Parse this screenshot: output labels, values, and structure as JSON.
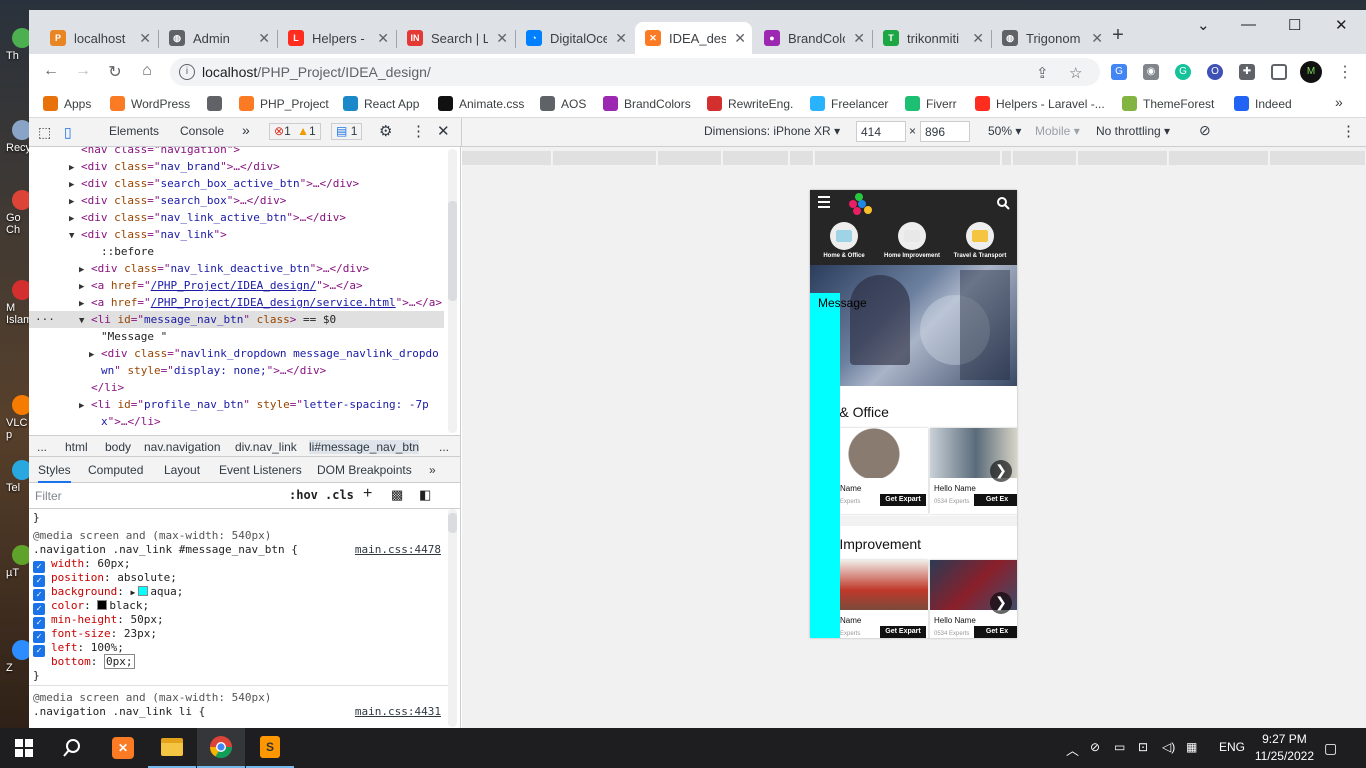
{
  "desktop": {
    "icons": [
      {
        "label": "Th",
        "color": "#4caf50"
      },
      {
        "label": "Recy",
        "color": "#8aa4c8"
      },
      {
        "label": "Go\nCh",
        "color": "#db4437"
      },
      {
        "label": "M\nIslam",
        "color": "#d32f2f"
      },
      {
        "label": "VLC\np",
        "color": "#f57c00"
      },
      {
        "label": "Tel",
        "color": "#29a8e0"
      },
      {
        "label": "µT",
        "color": "#5fa32b"
      },
      {
        "label": "Z",
        "color": "#2d8cff"
      }
    ]
  },
  "browser": {
    "tabs": [
      {
        "title": "localhost",
        "icon": "phpmyadmin-icon",
        "color": "#e98624",
        "glyph": "P"
      },
      {
        "title": "Admin",
        "icon": "globe-icon",
        "color": "#5f6368",
        "glyph": "◍"
      },
      {
        "title": "Helpers - L",
        "icon": "laravel-icon",
        "color": "#ff2d20",
        "glyph": "L"
      },
      {
        "title": "Search | Li",
        "icon": "indeed-icon",
        "color": "#e53935",
        "glyph": "IN"
      },
      {
        "title": "DigitalOce",
        "icon": "digitalocean-icon",
        "color": "#0080ff",
        "glyph": "◔"
      },
      {
        "title": "IDEA_desi",
        "icon": "xampp-icon",
        "color": "#fb7a24",
        "glyph": "✕",
        "active": true
      },
      {
        "title": "BrandColo",
        "icon": "brandcolors-icon",
        "color": "#9c27b0",
        "glyph": "●"
      },
      {
        "title": "trikonmiti",
        "icon": "trikonmiti-icon",
        "color": "#1ca644",
        "glyph": "T"
      },
      {
        "title": "Trigonom",
        "icon": "globe-icon",
        "color": "#5f6368",
        "glyph": "◍"
      }
    ],
    "new_tab": "+",
    "window_controls": {
      "dropdown": "⌄",
      "minimize": "—",
      "maximize": "☐",
      "close": "✕"
    },
    "nav": {
      "back": "←",
      "forward": "→",
      "reload": "↻",
      "home": "⌂"
    },
    "url": {
      "host": "localhost",
      "path": "/PHP_Project/IDEA_design/"
    },
    "bookmarks": [
      {
        "label": "Apps",
        "icon": "apps-grid-icon",
        "color": "#e8710a"
      },
      {
        "label": "WordPress",
        "icon": "xampp-icon",
        "color": "#fb7a24"
      },
      {
        "label": "",
        "icon": "globe-icon",
        "color": "#5f6368"
      },
      {
        "label": "PHP_Project",
        "icon": "xampp-icon",
        "color": "#fb7a24"
      },
      {
        "label": "React App",
        "icon": "react-icon",
        "color": "#1a88c9"
      },
      {
        "label": "Animate.css",
        "icon": "animate-icon",
        "color": "#111111"
      },
      {
        "label": "AOS",
        "icon": "globe-icon",
        "color": "#5f6368"
      },
      {
        "label": "BrandColors",
        "icon": "brandcolors-icon",
        "color": "#9c27b0"
      },
      {
        "label": "RewriteEng.",
        "icon": "rewrite-icon",
        "color": "#d32f2f"
      },
      {
        "label": "Freelancer",
        "icon": "freelancer-icon",
        "color": "#29b2fe"
      },
      {
        "label": "Fiverr",
        "icon": "fiverr-icon",
        "color": "#1dbf73"
      },
      {
        "label": "Helpers - Laravel -...",
        "icon": "laravel-icon",
        "color": "#ff2d20"
      },
      {
        "label": "ThemeForest",
        "icon": "themeforest-icon",
        "color": "#81b441"
      },
      {
        "label": "Indeed",
        "icon": "indeed-icon",
        "color": "#2164f3"
      }
    ],
    "bookmarks_more": "»"
  },
  "devtools": {
    "tabs": [
      "Elements",
      "Console"
    ],
    "more": "»",
    "errors": "1",
    "warnings": "1",
    "messages": "1",
    "device": {
      "dimensions_label": "Dimensions: iPhone XR",
      "width": "414",
      "times": "×",
      "height": "896",
      "zoom": "50%",
      "mobile": "Mobile",
      "throttling": "No throttling"
    },
    "dom_lines": [
      {
        "indent": 4,
        "tri": "",
        "parts": [
          [
            "t",
            "<nav class=\"navigation\">"
          ]
        ]
      },
      {
        "indent": 4,
        "tri": "▶",
        "parts": [
          [
            "t",
            "<div "
          ],
          [
            "a",
            "class"
          ],
          [
            "t",
            "=\""
          ],
          [
            "v",
            "nav_brand"
          ],
          [
            "t",
            "\">…</div>"
          ]
        ]
      },
      {
        "indent": 4,
        "tri": "▶",
        "parts": [
          [
            "t",
            "<div "
          ],
          [
            "a",
            "class"
          ],
          [
            "t",
            "=\""
          ],
          [
            "v",
            "search_box_active_btn"
          ],
          [
            "t",
            "\">…</div>"
          ]
        ]
      },
      {
        "indent": 4,
        "tri": "▶",
        "parts": [
          [
            "t",
            "<div "
          ],
          [
            "a",
            "class"
          ],
          [
            "t",
            "=\""
          ],
          [
            "v",
            "search_box"
          ],
          [
            "t",
            "\">…</div>"
          ]
        ]
      },
      {
        "indent": 4,
        "tri": "▶",
        "parts": [
          [
            "t",
            "<div "
          ],
          [
            "a",
            "class"
          ],
          [
            "t",
            "=\""
          ],
          [
            "v",
            "nav_link_active_btn"
          ],
          [
            "t",
            "\">…</div>"
          ]
        ]
      },
      {
        "indent": 4,
        "tri": "▼",
        "parts": [
          [
            "t",
            "<div "
          ],
          [
            "a",
            "class"
          ],
          [
            "t",
            "=\""
          ],
          [
            "v",
            "nav_link"
          ],
          [
            "t",
            "\">"
          ]
        ]
      },
      {
        "indent": 6,
        "tri": "",
        "parts": [
          [
            "x",
            "::before"
          ]
        ]
      },
      {
        "indent": 5,
        "tri": "▶",
        "parts": [
          [
            "t",
            "<div "
          ],
          [
            "a",
            "class"
          ],
          [
            "t",
            "=\""
          ],
          [
            "v",
            "nav_link_deactive_btn"
          ],
          [
            "t",
            "\">…</div>"
          ]
        ]
      },
      {
        "indent": 5,
        "tri": "▶",
        "parts": [
          [
            "t",
            "<a "
          ],
          [
            "a",
            "href"
          ],
          [
            "t",
            "=\""
          ],
          [
            "l",
            "/PHP_Project/IDEA_design/"
          ],
          [
            "t",
            "\">…</a>"
          ]
        ]
      },
      {
        "indent": 5,
        "tri": "▶",
        "parts": [
          [
            "t",
            "<a "
          ],
          [
            "a",
            "href"
          ],
          [
            "t",
            "=\""
          ],
          [
            "l",
            "/PHP_Project/IDEA_design/service.html"
          ],
          [
            "t",
            "\">…</a>"
          ]
        ]
      },
      {
        "indent": 5,
        "tri": "▼",
        "sel": true,
        "parts": [
          [
            "t",
            "<li "
          ],
          [
            "a",
            "id"
          ],
          [
            "t",
            "=\""
          ],
          [
            "v",
            "message_nav_btn"
          ],
          [
            "t",
            "\" "
          ],
          [
            "a",
            "class"
          ],
          [
            "t",
            "> "
          ],
          [
            "x",
            "== $0"
          ]
        ]
      },
      {
        "indent": 6,
        "tri": "",
        "parts": [
          [
            "x",
            "\"Message \""
          ]
        ]
      },
      {
        "indent": 6,
        "tri": "▶",
        "parts": [
          [
            "t",
            "<div "
          ],
          [
            "a",
            "class"
          ],
          [
            "t",
            "=\""
          ],
          [
            "v",
            "navlink_dropdown message_navlink_dropdo"
          ]
        ]
      },
      {
        "indent": 6,
        "tri": "",
        "parts": [
          [
            "v",
            "wn"
          ],
          [
            "t",
            "\" "
          ],
          [
            "a",
            "style"
          ],
          [
            "t",
            "=\""
          ],
          [
            "v",
            "display: none;"
          ],
          [
            "t",
            "\">…</div>"
          ]
        ]
      },
      {
        "indent": 5,
        "tri": "",
        "parts": [
          [
            "t",
            "</li>"
          ]
        ]
      },
      {
        "indent": 5,
        "tri": "▶",
        "parts": [
          [
            "t",
            "<li "
          ],
          [
            "a",
            "id"
          ],
          [
            "t",
            "=\""
          ],
          [
            "v",
            "profile_nav_btn"
          ],
          [
            "t",
            "\" "
          ],
          [
            "a",
            "style"
          ],
          [
            "t",
            "=\""
          ],
          [
            "v",
            "letter-spacing: -7p"
          ]
        ]
      },
      {
        "indent": 6,
        "tri": "",
        "parts": [
          [
            "v",
            "x"
          ],
          [
            "t",
            "\">…</li>"
          ]
        ]
      }
    ],
    "breadcrumbs": [
      "...",
      "html",
      "body",
      "nav.navigation",
      "div.nav_link",
      "li#message_nav_btn",
      "..."
    ],
    "style_tabs": [
      "Styles",
      "Computed",
      "Layout",
      "Event Listeners",
      "DOM Breakpoints",
      "»"
    ],
    "filter_placeholder": "Filter",
    "filter_hov": ":hov",
    "filter_cls": ".cls",
    "filter_plus": "+",
    "rule1": {
      "close_prev": "}",
      "media": "@media screen and (max-width: 540px)",
      "selector": ".navigation .nav_link #message_nav_btn {",
      "source": "main.css:4478",
      "props": [
        {
          "name": "width",
          "value": "60px;",
          "checked": true
        },
        {
          "name": "position",
          "value": "absolute;",
          "checked": true
        },
        {
          "name": "background",
          "value": "aqua;",
          "checked": true,
          "swatch": "#00ffff",
          "arrow": true
        },
        {
          "name": "color",
          "value": "black;",
          "checked": true,
          "swatch": "#000000"
        },
        {
          "name": "min-height",
          "value": "50px;",
          "checked": true
        },
        {
          "name": "font-size",
          "value": "23px;",
          "checked": true
        },
        {
          "name": "left",
          "value": "100%;",
          "checked": true
        },
        {
          "name": "bottom",
          "value": "0px;",
          "checked": false
        }
      ],
      "close": "}"
    },
    "rule2": {
      "media": "@media screen and (max-width: 540px)",
      "selector": ".navigation .nav_link li {",
      "source": "main.css:4431"
    }
  },
  "phone": {
    "categories": [
      "Home & Office",
      "Home Improvement",
      "Travel & Transport"
    ],
    "message_label": "Message",
    "section1": "me & Office",
    "section2": "me Improvement",
    "cards1": [
      {
        "name": "Name",
        "experts": "Experts",
        "button": "Get Expart"
      },
      {
        "name": "Hello Name",
        "experts": "0534 Experts",
        "button": "Get Ex"
      }
    ],
    "cards2": [
      {
        "name": "Name",
        "experts": "Experts",
        "button": "Get Expart"
      },
      {
        "name": "Hello Name",
        "experts": "0534 Experts",
        "button": "Get Ex"
      }
    ],
    "arrow": "❯",
    "colors": {
      "message_bg": "#00ffff",
      "nav_bg": "#262626"
    }
  },
  "taskbar": {
    "lang": "ENG",
    "time": "9:27 PM",
    "date": "11/25/2022"
  }
}
